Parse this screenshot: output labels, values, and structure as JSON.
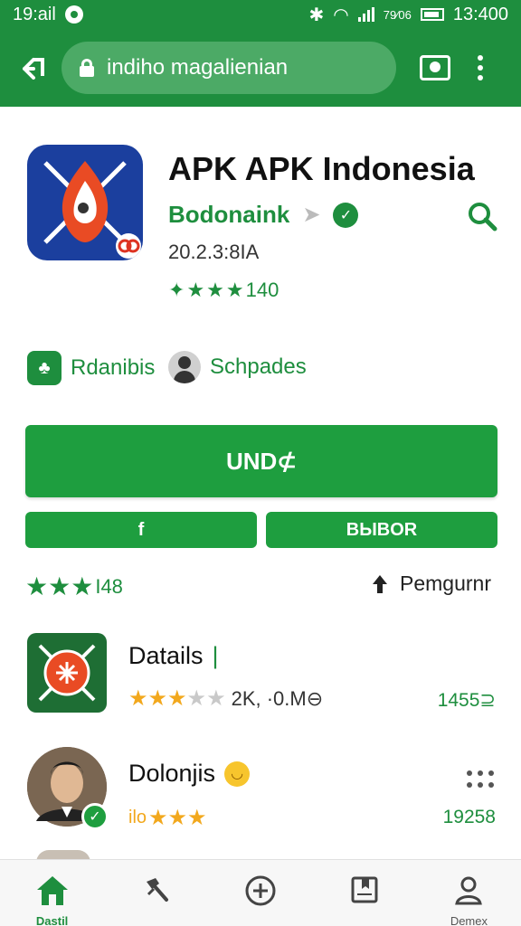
{
  "status_bar": {
    "time": "19:ail",
    "right_small": "79⁄06",
    "right_time": "13:400"
  },
  "toolbar": {
    "url": "indiho magalienian"
  },
  "app": {
    "title": "APK APK Indonesia",
    "developer": "Bodonaink",
    "version": "20.2.3:8IA",
    "rating_text": "140"
  },
  "chips": [
    {
      "label": "Rdanibis",
      "icon": "android-icon"
    },
    {
      "label": "Schpades",
      "icon": "user-avatar-icon"
    }
  ],
  "buttons": {
    "install": "UND⊄",
    "secondary_left": "f",
    "secondary_right": "BЫBOR"
  },
  "summary": {
    "rating": "I48",
    "pengumuman": "Pemgurnr"
  },
  "list": [
    {
      "title": "Datails",
      "sub": "2K, ·0.M⊖",
      "count": "1455⊇",
      "stars_filled": 3
    },
    {
      "title": "Dolonjis",
      "sub": "ilo",
      "count": "19258",
      "stars_filled": 3
    }
  ],
  "nav": [
    {
      "label": "Dastil",
      "icon": "home-icon"
    },
    {
      "label": "",
      "icon": "tools-icon"
    },
    {
      "label": "",
      "icon": "add-circle-icon"
    },
    {
      "label": "",
      "icon": "bookmark-icon"
    },
    {
      "label": "Demex",
      "icon": "profile-icon"
    }
  ],
  "colors": {
    "primary": "#1e8e3e",
    "button": "#1e9e3f",
    "star_orange": "#f2a81d"
  }
}
